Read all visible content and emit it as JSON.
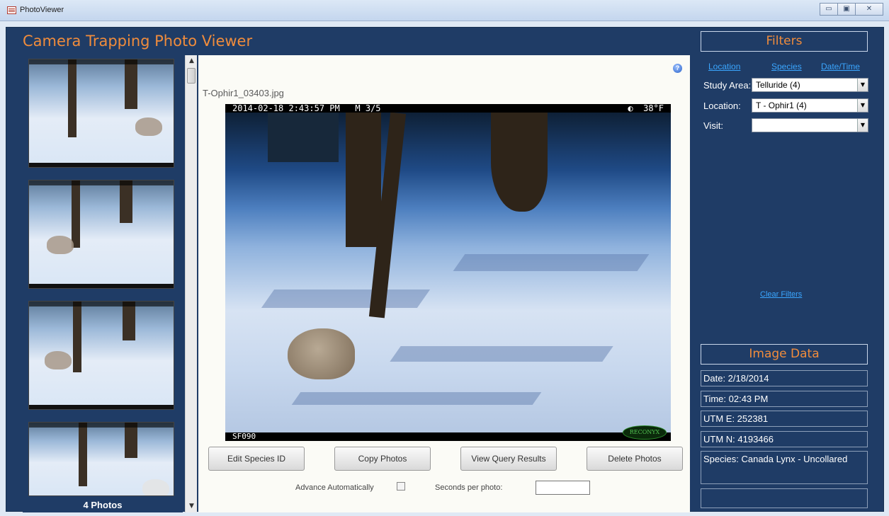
{
  "window": {
    "title": "PhotoViewer",
    "controls": [
      "minimize",
      "maximize",
      "close"
    ],
    "control_glyphs": {
      "minimize": "▭",
      "maximize": "▣",
      "close": "✕"
    }
  },
  "app": {
    "title": "Camera Trapping Photo Viewer",
    "accent_color": "#f08c3c",
    "background_color": "#1f3c66"
  },
  "thumbnails": {
    "count_label": "4 Photos",
    "items": [
      {
        "name": "thumb-1"
      },
      {
        "name": "thumb-2"
      },
      {
        "name": "thumb-3"
      },
      {
        "name": "thumb-4"
      }
    ]
  },
  "viewer": {
    "help_glyph": "?",
    "file_name": "T-Ophir1_03403.jpg",
    "photo_timestamp": "2014-02-18 2:43:57 PM   M 3/5",
    "photo_temp": "◐  38°F",
    "photo_code": "SF090",
    "photo_logo": "RECONYX",
    "buttons": {
      "edit_species": "Edit Species ID",
      "copy_photos": "Copy Photos",
      "view_query": "View Query Results",
      "delete_photos": "Delete Photos"
    },
    "advance_label": "Advance Automatically",
    "seconds_label": "Seconds per photo:",
    "seconds_value": ""
  },
  "filters": {
    "header": "Filters",
    "tabs": [
      "Location",
      "Species",
      "Date/Time"
    ],
    "study_area_label": "Study Area:",
    "study_area_value": "Telluride (4)",
    "location_label": "Location:",
    "location_value": "T - Ophir1 (4)",
    "visit_label": "Visit:",
    "visit_value": "",
    "clear_label": "Clear Filters",
    "link_color": "#3aa6ff"
  },
  "image_data": {
    "header": "Image Data",
    "date": "Date: 2/18/2014",
    "time": "Time: 02:43 PM",
    "utm_e": "UTM E: 252381",
    "utm_n": "UTM N: 4193466",
    "species": "Species: Canada Lynx - Uncollared",
    "extra": ""
  }
}
